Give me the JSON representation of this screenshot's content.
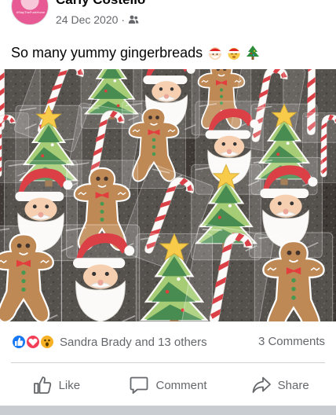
{
  "post": {
    "author": "Carly Costello",
    "date": "24 Dec 2020",
    "separator": "·",
    "privacy_icon": "friends-icon",
    "avatar_text": "#StayTheFuckHome",
    "caption": "So many yummy gingerbreads",
    "caption_emojis": [
      "santa-emoji",
      "mrs-claus-emoji",
      "christmas-tree-emoji"
    ]
  },
  "photo": {
    "subject": "gingerbread-cookies-photo"
  },
  "reactions": {
    "icons": [
      "like-reaction-icon",
      "love-reaction-icon",
      "wow-reaction-icon"
    ],
    "names": "Sandra Brady and 13 others",
    "comments": "3 Comments"
  },
  "actions": {
    "like": "Like",
    "comment": "Comment",
    "share": "Share"
  },
  "colors": {
    "secondary_text": "#65676b",
    "like_blue": "#1877f2",
    "love_red": "#f33e58",
    "wow_yellow": "#f7b125"
  }
}
